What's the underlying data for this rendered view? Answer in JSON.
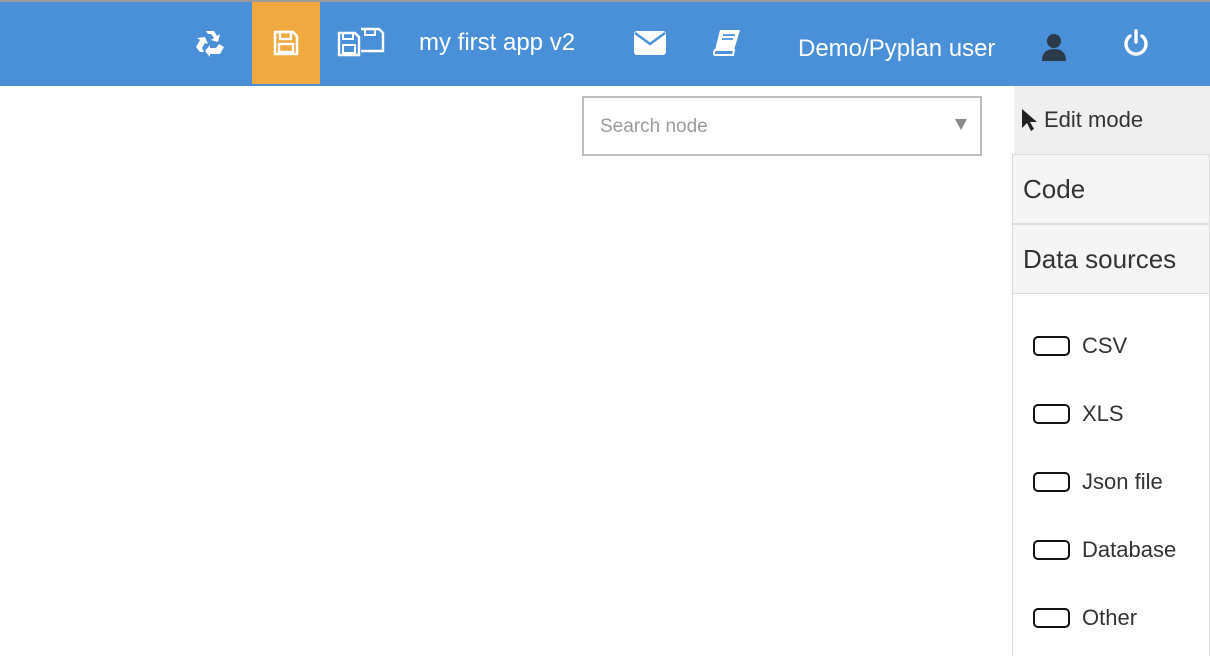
{
  "topbar": {
    "app_title": "my first app v2",
    "user_name": "Demo/Pyplan user",
    "bg_color": "#4a90d9",
    "active_color": "#f0a840",
    "icons": [
      "recycle-icon",
      "save-icon",
      "save-as-icon",
      "mail-icon",
      "book-icon",
      "user-icon",
      "power-icon"
    ]
  },
  "search": {
    "placeholder": "Search node"
  },
  "panel": {
    "edit_mode_label": "Edit mode",
    "code_label": "Code",
    "data_sources_label": "Data sources",
    "data_sources": [
      "CSV",
      "XLS",
      "Json file",
      "Database",
      "Other"
    ]
  }
}
